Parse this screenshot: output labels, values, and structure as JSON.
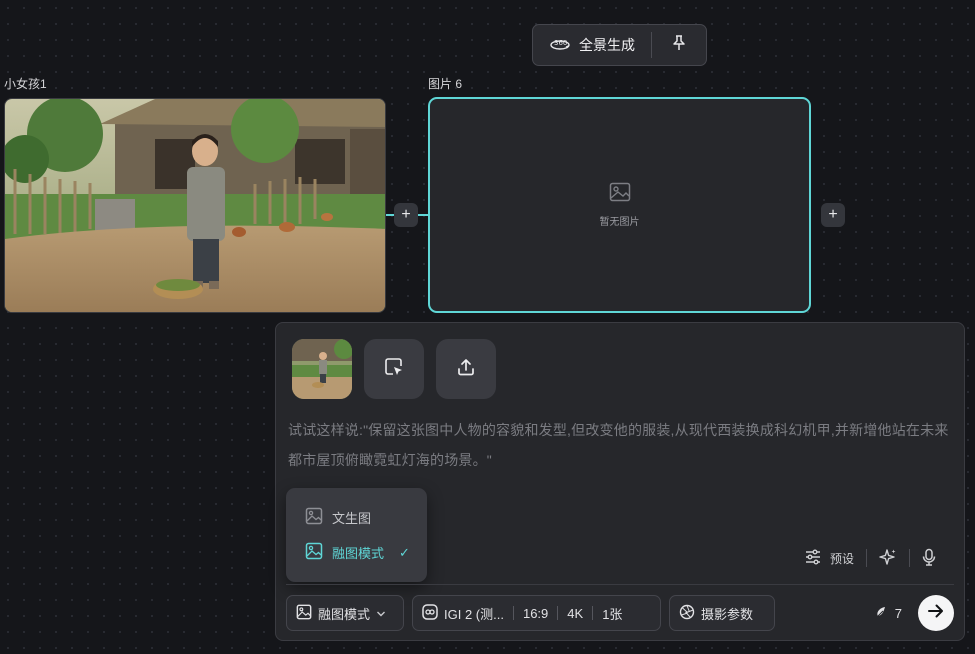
{
  "top_toolbar": {
    "generate_label": "全景生成",
    "generate_icon": "360-icon",
    "pin_icon": "pin-icon"
  },
  "nodes": [
    {
      "label": "小女孩1",
      "image": "girl-village-photo"
    },
    {
      "label": "图片 6",
      "empty_text": "暂无图片",
      "selected": true
    }
  ],
  "panel": {
    "reference_thumb": "girl-village-photo",
    "buttons": [
      {
        "icon": "select-region-icon"
      },
      {
        "icon": "upload-icon"
      }
    ],
    "prompt_placeholder": "试试这样说:\"保留这张图中人物的容貌和发型,但改变他的服装,从现代西装换成科幻机甲,并新增他站在未来都市屋顶俯瞰霓虹灯海的场景。\"",
    "mode_menu": {
      "items": [
        {
          "label": "文生图",
          "icon": "image-icon",
          "active": false
        },
        {
          "label": "融图模式",
          "icon": "image-icon",
          "active": true,
          "check": "✓"
        }
      ]
    },
    "tools": [
      {
        "label": "预设",
        "icon": "sliders-icon"
      },
      {
        "icon": "sparkle-icon"
      },
      {
        "icon": "mic-icon"
      }
    ],
    "bottom": {
      "mode_label": "融图模式",
      "model_label": "IGI 2 (测...",
      "ratio": "16:9",
      "resolution": "4K",
      "count": "1张",
      "camera_label": "摄影参数",
      "credits": "7"
    }
  },
  "colors": {
    "accent": "#5fd6d6",
    "background": "#15161a",
    "panel": "#26272b"
  }
}
